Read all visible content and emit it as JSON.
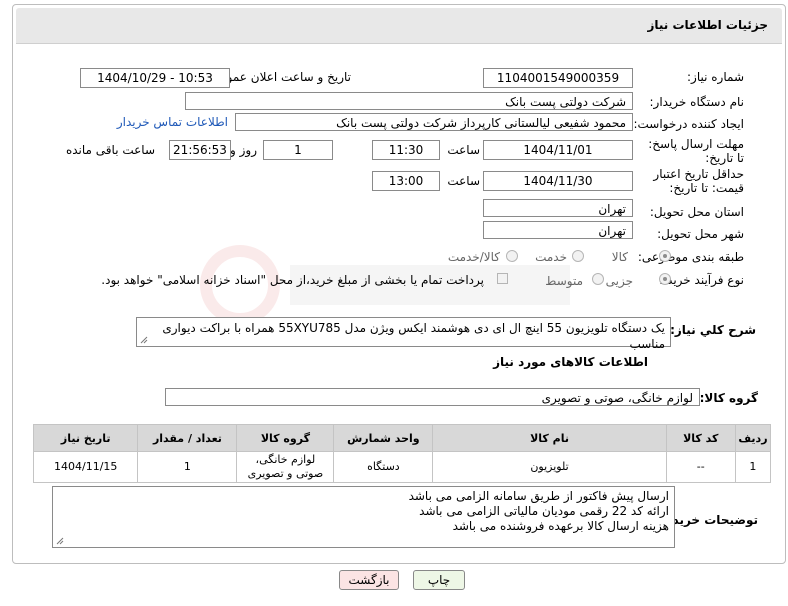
{
  "header": {
    "title": "جزئیات اطلاعات نیاز"
  },
  "form": {
    "need_number_label": "شماره نیاز:",
    "need_number": "1104001549000359",
    "announce_label": "تاریخ و ساعت اعلان عمومی:",
    "announce_value": "1404/10/29 - 10:53",
    "buyer_org_label": "نام دستگاه خریدار:",
    "buyer_org": "شرکت دولتی پست بانک",
    "requester_label": "ایجاد کننده درخواست:",
    "requester": "محمود شفیعی لیالستانی کارپرداز شرکت دولتی پست بانک",
    "contact_link": "اطلاعات تماس خریدار",
    "reply_deadline_label": "مهلت ارسال پاسخ: تا تاریخ:",
    "reply_date": "1404/11/01",
    "time_label": "ساعت",
    "reply_time": "11:30",
    "days_value": "1",
    "days_label": "روز و",
    "remaining_time": "21:56:53",
    "remaining_label": "ساعت باقی مانده",
    "price_validity_label": "حداقل تاریخ اعتبار قیمت: تا تاریخ:",
    "price_date": "1404/11/30",
    "price_time": "13:00",
    "province_label": "استان محل تحویل:",
    "province": "تهران",
    "city_label": "شهر محل تحویل:",
    "city": "تهران",
    "category_label": "طبقه بندی موضوعی:",
    "cat_goods": "کالا",
    "cat_service": "خدمت",
    "cat_goods_service": "کالا/خدمت",
    "process_label": "نوع فرآیند خرید :",
    "proc_partial": "جزیی",
    "proc_medium": "متوسط",
    "payment_note": "پرداخت تمام یا بخشی از مبلغ خرید،از محل \"اسناد خزانه اسلامی\" خواهد بود.",
    "general_desc_label": "شرح کلي نياز:",
    "general_desc": "یک دستگاه تلویزیون 55 اینچ ال ای دی هوشمند ایکس ویژن مدل 55XYU785 همراه با براکت دیواری مناسب"
  },
  "goods": {
    "section_title": "اطلاعات کالاهای مورد نیاز",
    "group_label": "گروه کالا:",
    "group_value": "لوازم خانگی، صوتی و تصویری",
    "columns": [
      "ردیف",
      "کد کالا",
      "نام کالا",
      "واحد شمارش",
      "گروه کالا",
      "تعداد / مقدار",
      "تاریخ نیاز"
    ],
    "rows": [
      {
        "row": "1",
        "code": "--",
        "name": "تلویزیون",
        "unit": "دستگاه",
        "group_line1": "لوازم خانگی،",
        "group_line2": "صوتی و تصویری",
        "qty": "1",
        "date": "1404/11/15"
      }
    ]
  },
  "buyer_notes": {
    "label": "توضیحات خریدار:",
    "line1": "ارسال پیش فاکتور از طریق سامانه الزامی می باشد",
    "line2": "ارائه کد 22 رقمی مودیان مالیاتی الزامی می باشد",
    "line3": "هزینه ارسال کالا برعهده فروشنده می باشد"
  },
  "buttons": {
    "print": "چاپ",
    "back": "بازگشت"
  },
  "colors": {
    "header_bg": "#e8e8e8",
    "link": "#1f59b8",
    "print_btn": "#eef7e6",
    "back_btn": "#fbe4e4"
  }
}
